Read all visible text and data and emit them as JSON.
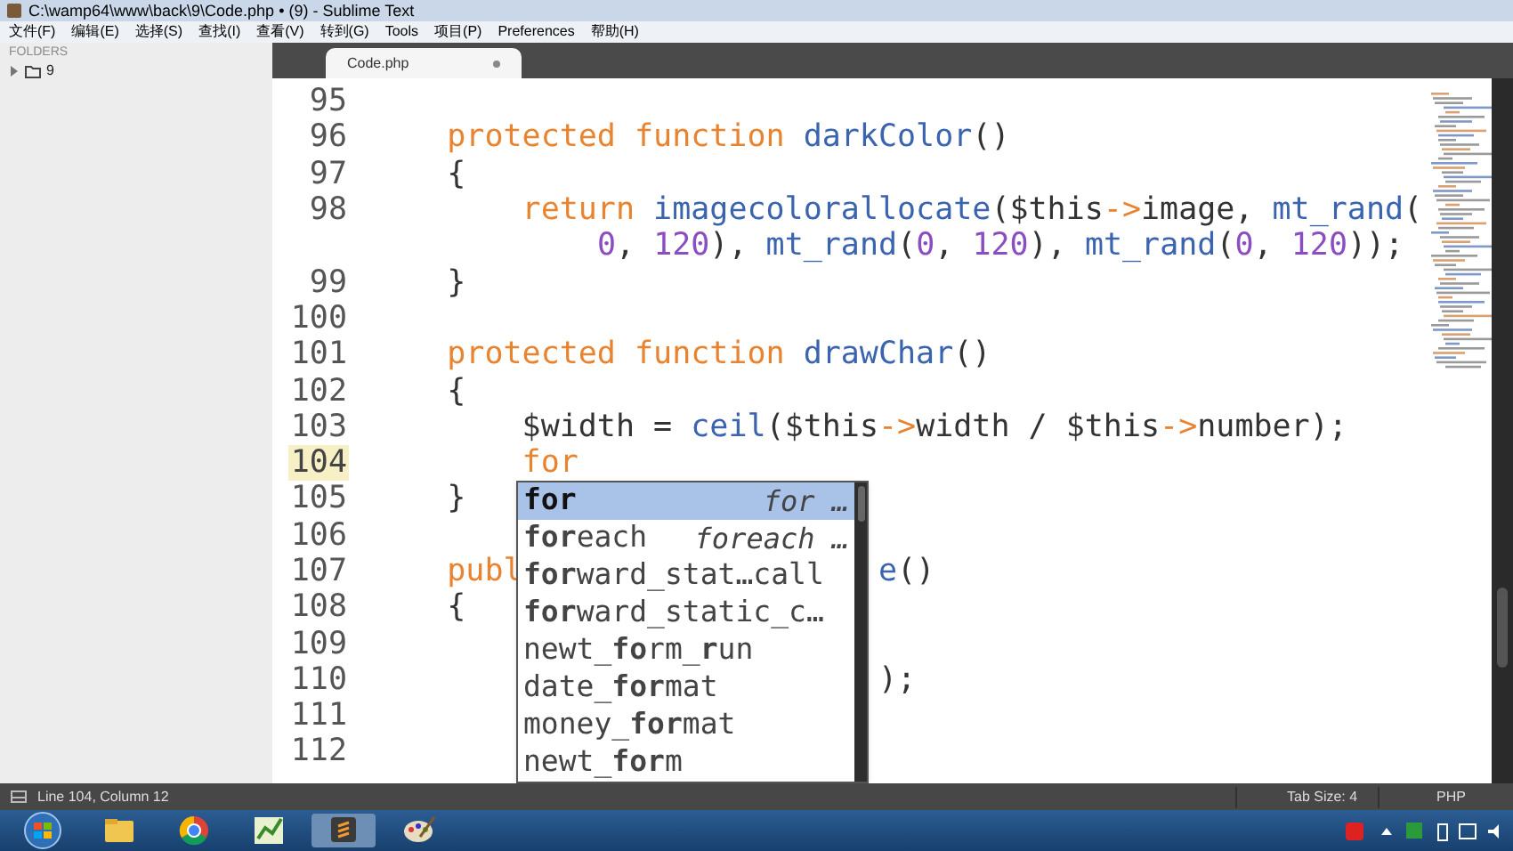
{
  "window": {
    "title": "C:\\wamp64\\www\\back\\9\\Code.php • (9) - Sublime Text"
  },
  "menu": [
    "文件(F)",
    "编辑(E)",
    "选择(S)",
    "查找(I)",
    "查看(V)",
    "转到(G)",
    "Tools",
    "项目(P)",
    "Preferences",
    "帮助(H)"
  ],
  "sidebar": {
    "heading": "FOLDERS",
    "items": [
      {
        "label": "9",
        "expanded": false
      }
    ]
  },
  "tabs": [
    {
      "label": "Code.php",
      "selected": true,
      "modified": true
    }
  ],
  "editor": {
    "lines": [
      {
        "number": "95",
        "current": false
      },
      {
        "number": "96",
        "current": false,
        "wraps": [
          {
            "kind": "line",
            "tokens": [
              {
                "kind": "kw",
                "text": "    protected function "
              },
              {
                "kind": "name",
                "text": "darkColor"
              },
              {
                "kind": "plain",
                "text": "()"
              }
            ]
          }
        ]
      },
      {
        "number": "97",
        "current": false,
        "wraps": [
          {
            "kind": "line",
            "tokens": [
              {
                "kind": "plain",
                "text": "    {"
              }
            ]
          }
        ]
      },
      {
        "number": "98",
        "current": false,
        "wraps": [
          {
            "kind": "line",
            "tokens": [
              {
                "kind": "kw",
                "text": "        return "
              },
              {
                "kind": "name",
                "text": "imagecolorallocate"
              },
              {
                "kind": "plain",
                "text": "($this"
              },
              {
                "kind": "kw",
                "text": "->"
              },
              {
                "kind": "plain",
                "text": "image, "
              },
              {
                "kind": "name",
                "text": "mt_rand"
              },
              {
                "kind": "plain",
                "text": "("
              }
            ]
          },
          {
            "kind": "continuation",
            "tokens": [
              {
                "kind": "num",
                "text": "0"
              },
              {
                "kind": "plain",
                "text": ", "
              },
              {
                "kind": "num",
                "text": "120"
              },
              {
                "kind": "plain",
                "text": "), "
              },
              {
                "kind": "name",
                "text": "mt_rand"
              },
              {
                "kind": "plain",
                "text": "("
              },
              {
                "kind": "num",
                "text": "0"
              },
              {
                "kind": "plain",
                "text": ", "
              },
              {
                "kind": "num",
                "text": "120"
              },
              {
                "kind": "plain",
                "text": "), "
              },
              {
                "kind": "name",
                "text": "mt_rand"
              },
              {
                "kind": "plain",
                "text": "("
              },
              {
                "kind": "num",
                "text": "0"
              },
              {
                "kind": "plain",
                "text": ", "
              },
              {
                "kind": "num",
                "text": "120"
              },
              {
                "kind": "plain",
                "text": "));"
              }
            ]
          }
        ]
      },
      {
        "number": "99",
        "current": false,
        "wraps": [
          {
            "kind": "line",
            "tokens": [
              {
                "kind": "plain",
                "text": "    }"
              }
            ]
          }
        ]
      },
      {
        "number": "100",
        "current": false
      },
      {
        "number": "101",
        "current": false,
        "wraps": [
          {
            "kind": "line",
            "tokens": [
              {
                "kind": "kw",
                "text": "    protected function "
              },
              {
                "kind": "name",
                "text": "drawChar"
              },
              {
                "kind": "plain",
                "text": "()"
              }
            ]
          }
        ]
      },
      {
        "number": "102",
        "current": false,
        "wraps": [
          {
            "kind": "line",
            "tokens": [
              {
                "kind": "plain",
                "text": "    {"
              }
            ]
          }
        ]
      },
      {
        "number": "103",
        "current": false,
        "wraps": [
          {
            "kind": "line",
            "tokens": [
              {
                "kind": "plain",
                "text": "        $width = "
              },
              {
                "kind": "name",
                "text": "ceil"
              },
              {
                "kind": "plain",
                "text": "($this"
              },
              {
                "kind": "kw",
                "text": "->"
              },
              {
                "kind": "plain",
                "text": "width / $this"
              },
              {
                "kind": "kw",
                "text": "->"
              },
              {
                "kind": "plain",
                "text": "number);"
              }
            ]
          }
        ]
      },
      {
        "number": "104",
        "current": true,
        "wraps": [
          {
            "kind": "line",
            "tokens": [
              {
                "kind": "kw",
                "text": "        for"
              }
            ]
          }
        ]
      },
      {
        "number": "105",
        "current": false,
        "wraps": [
          {
            "kind": "line",
            "tokens": [
              {
                "kind": "plain",
                "text": "    }"
              }
            ]
          }
        ]
      },
      {
        "number": "106",
        "current": false
      },
      {
        "number": "107",
        "current": false,
        "wraps": [
          {
            "kind": "line",
            "tokens": [
              {
                "kind": "kw",
                "text": "    publ"
              }
            ],
            "after_popup": [
              {
                "kind": "name",
                "text": "e"
              },
              {
                "kind": "plain",
                "text": "()"
              }
            ]
          }
        ]
      },
      {
        "number": "108",
        "current": false,
        "wraps": [
          {
            "kind": "line",
            "tokens": [
              {
                "kind": "plain",
                "text": "    {"
              }
            ]
          }
        ]
      },
      {
        "number": "109",
        "current": false
      },
      {
        "number": "110",
        "current": false,
        "wraps": [
          {
            "kind": "line",
            "after_popup": [
              {
                "kind": "plain",
                "text": ");"
              }
            ]
          }
        ]
      },
      {
        "number": "111",
        "current": false
      },
      {
        "number": "112",
        "current": false
      }
    ]
  },
  "completions": [
    {
      "label": "**for**",
      "hint": "for …",
      "selected": true
    },
    {
      "label": "**for**each",
      "hint": "foreach …",
      "selected": false
    },
    {
      "label": "**for**ward_stat…call",
      "selected": false
    },
    {
      "label": "**for**ward_static_c…",
      "selected": false
    },
    {
      "label": "newt_**fo**rm_**r**un",
      "selected": false
    },
    {
      "label": "date_**for**mat",
      "selected": false
    },
    {
      "label": "money_**for**mat",
      "selected": false
    },
    {
      "label": "newt_**for**m",
      "selected": false
    }
  ],
  "status_bar": {
    "position": "Line 104, Column 12",
    "tab_size": "Tab Size: 4",
    "syntax": "PHP"
  }
}
